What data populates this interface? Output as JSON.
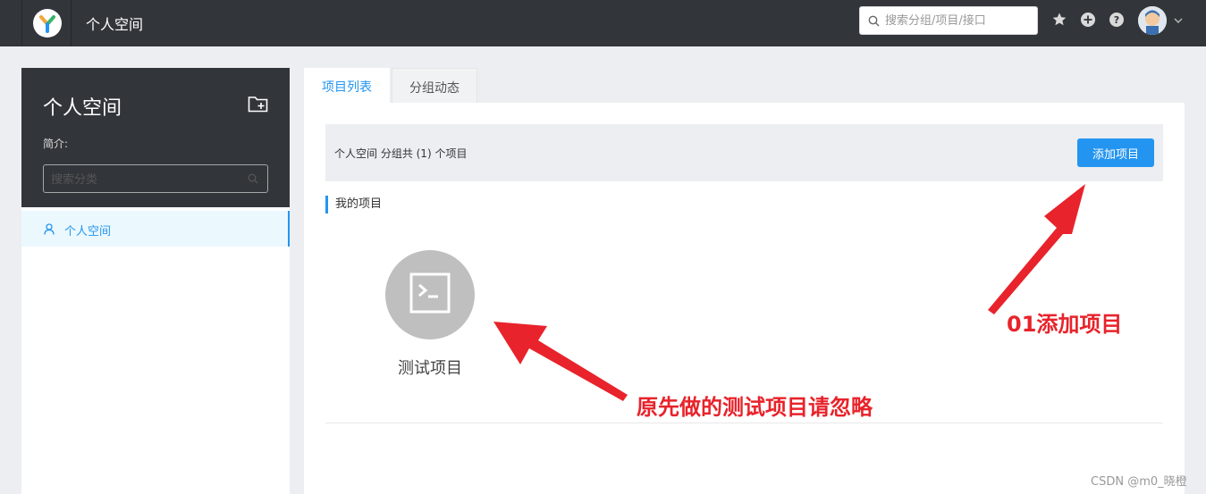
{
  "topbar": {
    "title": "个人空间",
    "search_placeholder": "搜索分组/项目/接口"
  },
  "sidebar": {
    "title": "个人空间",
    "description_label": "简介:",
    "search_placeholder": "搜索分类",
    "groups": [
      {
        "label": "个人空间"
      }
    ]
  },
  "tabs": [
    {
      "label": "项目列表",
      "active": true
    },
    {
      "label": "分组动态",
      "active": false
    }
  ],
  "main": {
    "summary": "个人空间 分组共 (1) 个项目",
    "add_button": "添加项目",
    "section_title": "我的项目",
    "projects": [
      {
        "name": "测试项目"
      }
    ]
  },
  "annotations": {
    "add_project_note": "01添加项目",
    "ignore_note": "原先做的测试项目请忽略"
  },
  "watermark": "CSDN @m0_晓橙",
  "colors": {
    "accent": "#2395f1",
    "topbar": "#32363a",
    "annotation": "#e8232b"
  }
}
